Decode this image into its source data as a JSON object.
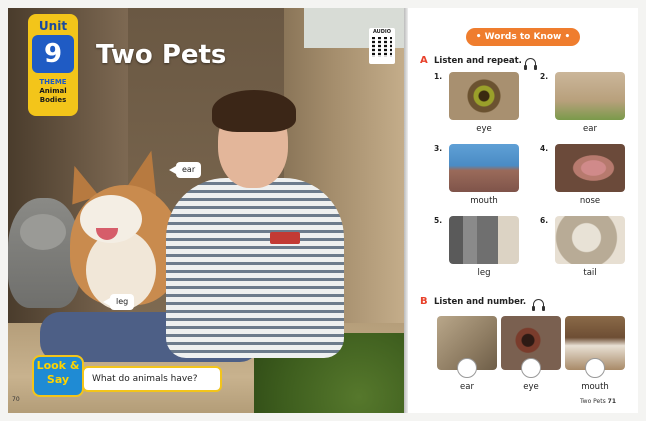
{
  "left_page": {
    "unit_label": "Unit",
    "unit_number": "9",
    "theme_label": "THEME",
    "theme_text": "Animal Bodies",
    "title": "Two Pets",
    "audio_label": "AUDIO",
    "tags": {
      "ear": "ear",
      "leg": "leg"
    },
    "look_say": "Look & Say",
    "question": "What do animals have?",
    "page_number": "70"
  },
  "right_page": {
    "banner": "• Words to Know •",
    "section_a": {
      "letter": "A",
      "title": "Listen and repeat.",
      "items": [
        {
          "num": "1.",
          "word": "eye"
        },
        {
          "num": "2.",
          "word": "ear"
        },
        {
          "num": "3.",
          "word": "mouth"
        },
        {
          "num": "4.",
          "word": "nose"
        },
        {
          "num": "5.",
          "word": "leg"
        },
        {
          "num": "6.",
          "word": "tail"
        }
      ]
    },
    "section_b": {
      "letter": "B",
      "title": "Listen and number.",
      "items": [
        {
          "word": "ear"
        },
        {
          "word": "eye"
        },
        {
          "word": "mouth"
        }
      ]
    },
    "footer_title": "Two Pets",
    "page_number": "71"
  }
}
